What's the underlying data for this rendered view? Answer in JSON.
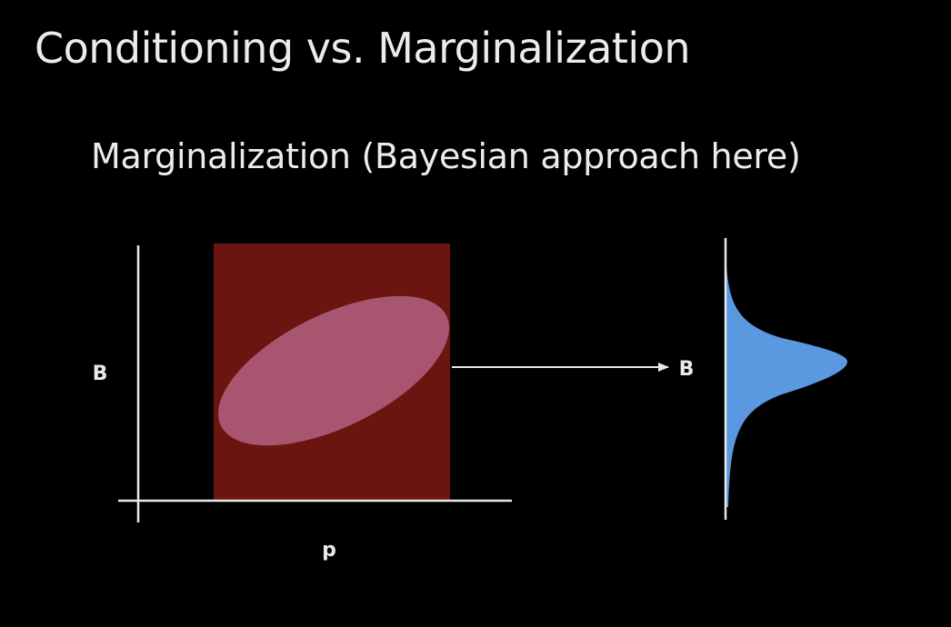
{
  "slide": {
    "title": "Conditioning vs. Marginalization",
    "subtitle": "Marginalization (Bayesian approach here)"
  },
  "diagram": {
    "joint_plot": {
      "y_axis_label": "B",
      "x_axis_label": "p"
    },
    "marginal_plot": {
      "axis_label": "B"
    },
    "colors": {
      "background": "#000000",
      "prior_box": "#6a1510",
      "joint_ellipse": "#a8556f",
      "marginal_density": "#5a99e0",
      "axes": "#e8e8e8"
    }
  }
}
